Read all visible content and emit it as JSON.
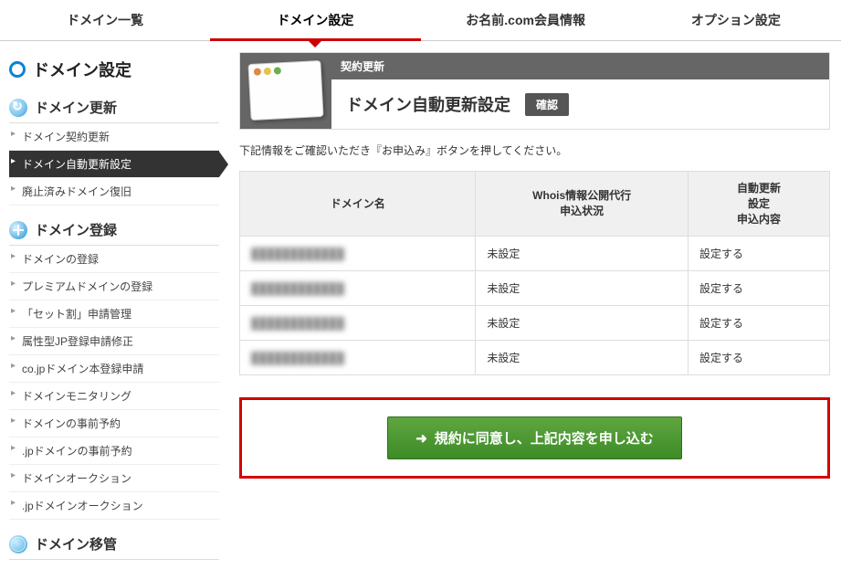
{
  "tabs": [
    "ドメイン一覧",
    "ドメイン設定",
    "お名前.com会員情報",
    "オプション設定"
  ],
  "activeTab": 1,
  "pageTitle": "ドメイン設定",
  "sidebar": {
    "sections": [
      {
        "title": "ドメイン更新",
        "icon": "refresh",
        "items": [
          "ドメイン契約更新",
          "ドメイン自動更新設定",
          "廃止済みドメイン復旧"
        ],
        "activeIndex": 1
      },
      {
        "title": "ドメイン登録",
        "icon": "plus",
        "items": [
          "ドメインの登録",
          "プレミアムドメインの登録",
          "「セット割」申請管理",
          "属性型JP登録申請修正",
          "co.jpドメイン本登録申請",
          "ドメインモニタリング",
          "ドメインの事前予約",
          ".jpドメインの事前予約",
          "ドメインオークション",
          ".jpドメインオークション"
        ]
      },
      {
        "title": "ドメイン移管",
        "icon": "globe",
        "items": []
      }
    ]
  },
  "header": {
    "label": "契約更新",
    "title": "ドメイン自動更新設定",
    "badge": "確認"
  },
  "instruction": "下記情報をご確認いただき『お申込み』ボタンを押してください。",
  "table": {
    "headers": [
      "ドメイン名",
      "Whois情報公開代行\n申込状況",
      "自動更新\n設定\n申込内容"
    ],
    "rows": [
      {
        "domain": "████████████",
        "whois": "未設定",
        "auto": "設定する"
      },
      {
        "domain": "████████████",
        "whois": "未設定",
        "auto": "設定する"
      },
      {
        "domain": "████████████",
        "whois": "未設定",
        "auto": "設定する"
      },
      {
        "domain": "████████████",
        "whois": "未設定",
        "auto": "設定する"
      }
    ]
  },
  "submitLabel": "規約に同意し、上記内容を申し込む"
}
